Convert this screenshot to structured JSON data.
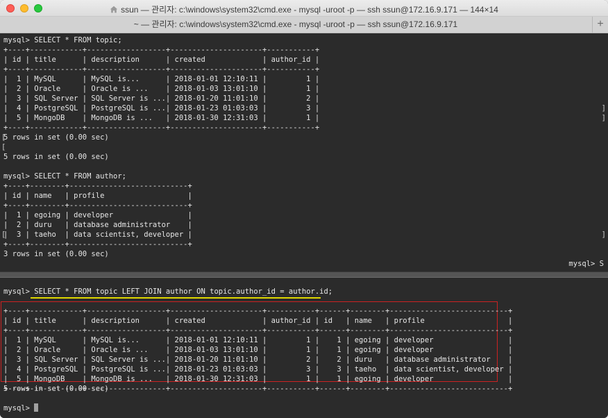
{
  "window": {
    "title": "ssun — 관리자: c:\\windows\\system32\\cmd.exe - mysql  -uroot -p — ssh ssun@172.16.9.171 — 144×14",
    "tab_title": "~ — 관리자: c:\\windows\\system32\\cmd.exe - mysql  -uroot -p — ssh ssun@172.16.9.171",
    "add_tab_label": "+"
  },
  "top_pane": {
    "lines": [
      "mysql> SELECT * FROM topic;",
      "+----+------------+------------------+---------------------+-----------+",
      "| id | title      | description      | created             | author_id |",
      "+----+------------+------------------+---------------------+-----------+",
      "|  1 | MySQL      | MySQL is...      | 2018-01-01 12:10:11 |         1 |",
      "|  2 | Oracle     | Oracle is ...    | 2018-01-03 13:01:10 |         1 |",
      "|  3 | SQL Server | SQL Server is ...| 2018-01-20 11:01:10 |         2 |",
      "|  4 | PostgreSQL | PostgreSQL is ...| 2018-01-23 01:03:03 |         3 |",
      "|  5 | MongoDB    | MongoDB is ...   | 2018-01-30 12:31:03 |         1 |",
      "+----+------------+------------------+---------------------+-----------+",
      "5 rows in set (0.00 sec)",
      "",
      "5 rows in set (0.00 sec)",
      "",
      "mysql> SELECT * FROM author;",
      "+----+--------+---------------------------+",
      "| id | name   | profile                   |",
      "+----+--------+---------------------------+",
      "|  1 | egoing | developer                 |",
      "|  2 | duru   | database administrator    |",
      "|  3 | taeho  | data scientist, developer |",
      "+----+--------+---------------------------+",
      "3 rows in set (0.00 sec)"
    ],
    "side_prompt": "mysql> S"
  },
  "bottom_pane": {
    "prompt": "mysql> ",
    "command": "SELECT * FROM topic LEFT JOIN author ON topic.author_id = author.id;",
    "result_lines": [
      "+----+------------+------------------+---------------------+-----------+------+--------+---------------------------+",
      "| id | title      | description      | created             | author_id | id   | name   | profile                   |",
      "+----+------------+------------------+---------------------+-----------+------+--------+---------------------------+",
      "|  1 | MySQL      | MySQL is...      | 2018-01-01 12:10:11 |         1 |    1 | egoing | developer                 |",
      "|  2 | Oracle     | Oracle is ...    | 2018-01-03 13:01:10 |         1 |    1 | egoing | developer                 |",
      "|  3 | SQL Server | SQL Server is ...| 2018-01-20 11:01:10 |         2 |    2 | duru   | database administrator    |",
      "|  4 | PostgreSQL | PostgreSQL is ...| 2018-01-23 01:03:03 |         3 |    3 | taeho  | data scientist, developer |",
      "|  5 | MongoDB    | MongoDB is ...   | 2018-01-30 12:31:03 |         1 |    1 | egoing | developer                 |",
      "+----+------------+------------------+---------------------+-----------+------+--------+---------------------------+"
    ],
    "footer": "5 rows in set (0.00 sec)",
    "final_prompt": "mysql> "
  },
  "colors": {
    "terminal_bg": "#2b2b2b",
    "terminal_text": "#e6e6e6",
    "highlight_underline": "#e0d800",
    "result_box_border": "#cc2222"
  },
  "icons": {
    "title_icon": "home-icon",
    "cursor": "terminal-cursor"
  }
}
